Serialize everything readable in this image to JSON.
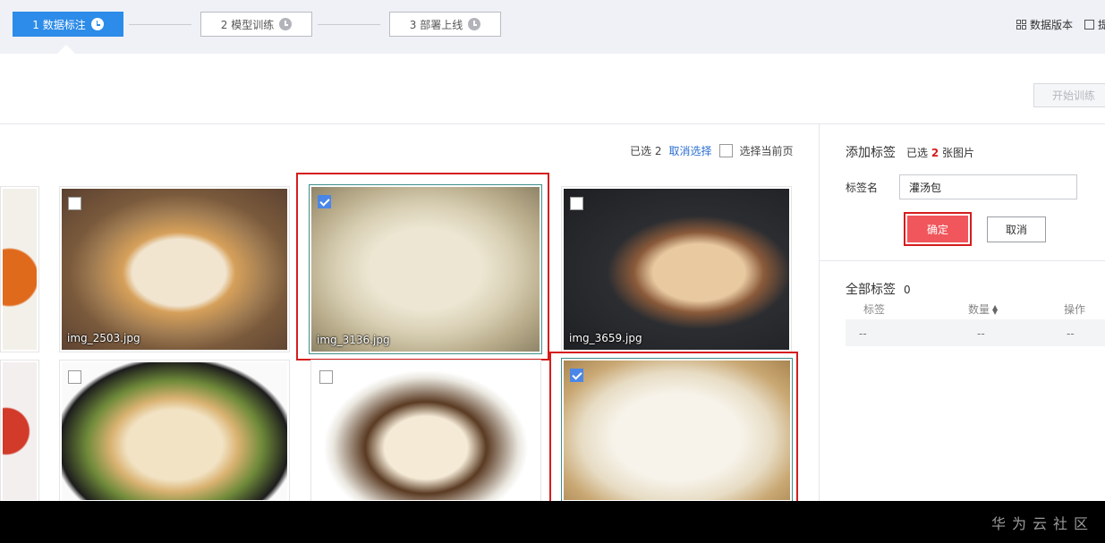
{
  "steps": [
    {
      "label": "1 数据标注",
      "active": true
    },
    {
      "label": "2 模型训练",
      "active": false
    },
    {
      "label": "3 部署上线",
      "active": false
    }
  ],
  "top_right": {
    "data_version": "数据版本",
    "edit_partial": "提"
  },
  "toolbar": {
    "start_training": "开始训练"
  },
  "selection": {
    "selected_prefix": "已选",
    "selected_count": "2",
    "cancel_selection": "取消选择",
    "select_current_page": "选择当前页"
  },
  "images": [
    {
      "name": "img_2503.jpg",
      "checked": false
    },
    {
      "name": "img_3136.jpg",
      "checked": true
    },
    {
      "name": "img_3659.jpg",
      "checked": false
    },
    {
      "name": "",
      "checked": false
    },
    {
      "name": "",
      "checked": false
    },
    {
      "name": "",
      "checked": true
    }
  ],
  "label_panel": {
    "add_label_title": "添加标签",
    "selected_prefix": "已选",
    "selected_count": "2",
    "selected_suffix": "张图片",
    "label_name_caption": "标签名",
    "label_name_value": "灌汤包",
    "confirm": "确定",
    "cancel": "取消"
  },
  "all_labels": {
    "title": "全部标签",
    "count": "0",
    "columns": [
      "标签",
      "数量",
      "操作"
    ],
    "rows": [
      [
        "--",
        "--",
        "--"
      ]
    ]
  },
  "watermark": "华为云社区",
  "colors": {
    "accent": "#2d8ce9",
    "highlight_red": "#d51d1d",
    "confirm_red": "#f0565c",
    "selected_count_red": "#d51d1d"
  }
}
